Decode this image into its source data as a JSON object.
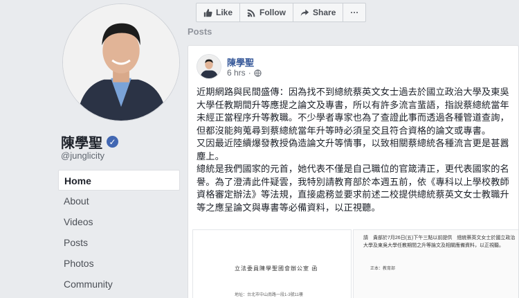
{
  "page": {
    "name": "陳學聖",
    "handle": "@junglicity",
    "verified_icon": "check-icon"
  },
  "nav": {
    "items": [
      {
        "label": "Home"
      },
      {
        "label": "About"
      },
      {
        "label": "Videos"
      },
      {
        "label": "Posts"
      },
      {
        "label": "Photos"
      },
      {
        "label": "Community"
      }
    ]
  },
  "actions": {
    "like": "Like",
    "follow": "Follow",
    "share": "Share",
    "more": "···"
  },
  "posts_heading": "Posts",
  "post": {
    "author": "陳學聖",
    "time": "6 hrs",
    "dot": "·",
    "paragraphs": [
      "近期網路與民間盛傳：因為找不到總統蔡英文女士過去於國立政治大學及東吳大學任教期間升等應提之論文及專書，所以有許多流言蜚語，指說蔡總統當年未經正當程序升等教職。不少學者專家也為了查證此事而透過各種管道查詢，但都沒能夠蒐尋到蔡總統當年升等時必須呈交且符合資格的論文或專書。",
      "又因最近陸續爆發教授偽造論文升等情事，以致相關蔡總統各種流言更是甚囂塵上。",
      "總統是我們國家的元首，她代表不僅是自己職位的官箴清正，更代表國家的名譽。為了澄清此件疑雲，我特別請教育部於本週五前，依《專科以上學校教師資格審定辦法》等法規，直接處務並要求前述二校提供總統蔡英文女士教職升等之應呈論文與專書等必備資料，以正視聽。"
    ]
  },
  "attachments": {
    "left_title": "立法委員陳學聖國會辦公室  函",
    "left_sub": "地址：台北市中山南路一段1-3號11樓",
    "right_text": "請　貴部於7月26日(五)下午三點以前提供　總統蔡英文女士於國立政治大學及東吳大學任教期間之升等論文及相關應備資料，以正視聽。",
    "right_sign": "正本：教育部"
  },
  "colors": {
    "background": "#e9ebee",
    "link": "#365899",
    "verified": "#4267b2"
  }
}
